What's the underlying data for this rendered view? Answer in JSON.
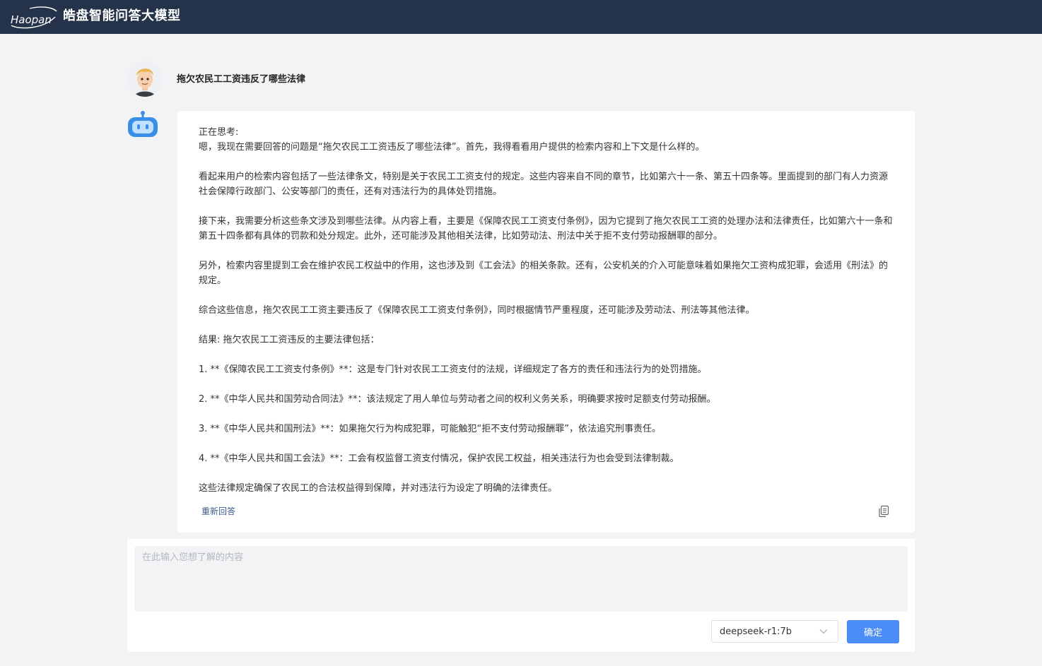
{
  "header": {
    "logo_text": "Haopan",
    "title": "皓盘智能问答大模型"
  },
  "conversation": {
    "question": "拖欠农民工工资违反了哪些法律",
    "answer_paragraphs": [
      "正在思考:",
      "嗯，我现在需要回答的问题是“拖欠农民工工资违反了哪些法律”。首先，我得看看用户提供的检索内容和上下文是什么样的。",
      "",
      "看起来用户的检索内容包括了一些法律条文，特别是关于农民工工资支付的规定。这些内容来自不同的章节，比如第六十一条、第五十四条等。里面提到的部门有人力资源社会保障行政部门、公安等部门的责任，还有对违法行为的具体处罚措施。",
      "",
      "接下来，我需要分析这些条文涉及到哪些法律。从内容上看，主要是《保障农民工工资支付条例》，因为它提到了拖欠农民工工资的处理办法和法律责任，比如第六十一条和第五十四条都有具体的罚款和处分规定。此外，还可能涉及其他相关法律，比如劳动法、刑法中关于拒不支付劳动报酬罪的部分。",
      "",
      "另外，检索内容里提到工会在维护农民工权益中的作用，这也涉及到《工会法》的相关条款。还有，公安机关的介入可能意味着如果拖欠工资构成犯罪，会适用《刑法》的规定。",
      "",
      "综合这些信息，拖欠农民工工资主要违反了《保障农民工工资支付条例》，同时根据情节严重程度，还可能涉及劳动法、刑法等其他法律。",
      "",
      "结果: 拖欠农民工工资违反的主要法律包括：",
      "",
      "1. **《保障农民工工资支付条例》**：这是专门针对农民工工资支付的法规，详细规定了各方的责任和违法行为的处罚措施。",
      "",
      "2. **《中华人民共和国劳动合同法》**：该法规定了用人单位与劳动者之间的权利义务关系，明确要求按时足额支付劳动报酬。",
      "",
      "3. **《中华人民共和国刑法》**：如果拖欠行为构成犯罪，可能触犯“拒不支付劳动报酬罪”，依法追究刑事责任。",
      "",
      "4. **《中华人民共和国工会法》**：工会有权监督工资支付情况，保护农民工权益，相关违法行为也会受到法律制裁。",
      "",
      "这些法律规定确保了农民工的合法权益得到保障，并对违法行为设定了明确的法律责任。"
    ],
    "regenerate_label": "重新回答"
  },
  "composer": {
    "placeholder": "在此输入您想了解的内容",
    "value": "",
    "model_selected": "deepseek-r1:7b",
    "confirm_label": "确定"
  },
  "colors": {
    "topbar": "#243349",
    "accent": "#4b8df8",
    "link": "#3a5a8c",
    "page_bg": "#f2f3f5"
  },
  "icons": {
    "user": "user-avatar-icon",
    "bot": "robot-icon",
    "copy": "copy-icon",
    "dropdown": "chevron-down-icon"
  }
}
